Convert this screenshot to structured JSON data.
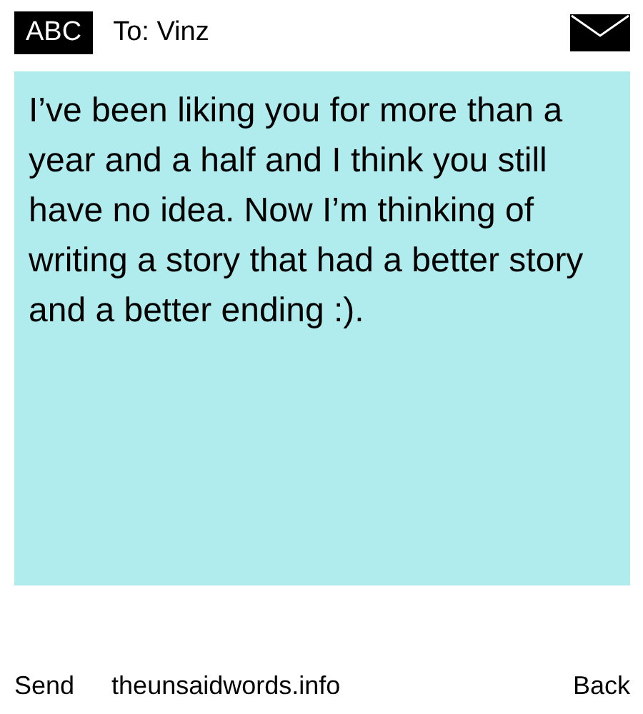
{
  "header": {
    "input_mode": "ABC",
    "recipient": "To: Vinz"
  },
  "message": {
    "value": "I’ve been liking you for more than a year and a half and I think you still have no idea. Now I’m thinking of writing a story that had a better story and a better ending :)."
  },
  "footer": {
    "left": "Send",
    "center": "theunsaidwords.info",
    "right": "Back"
  }
}
